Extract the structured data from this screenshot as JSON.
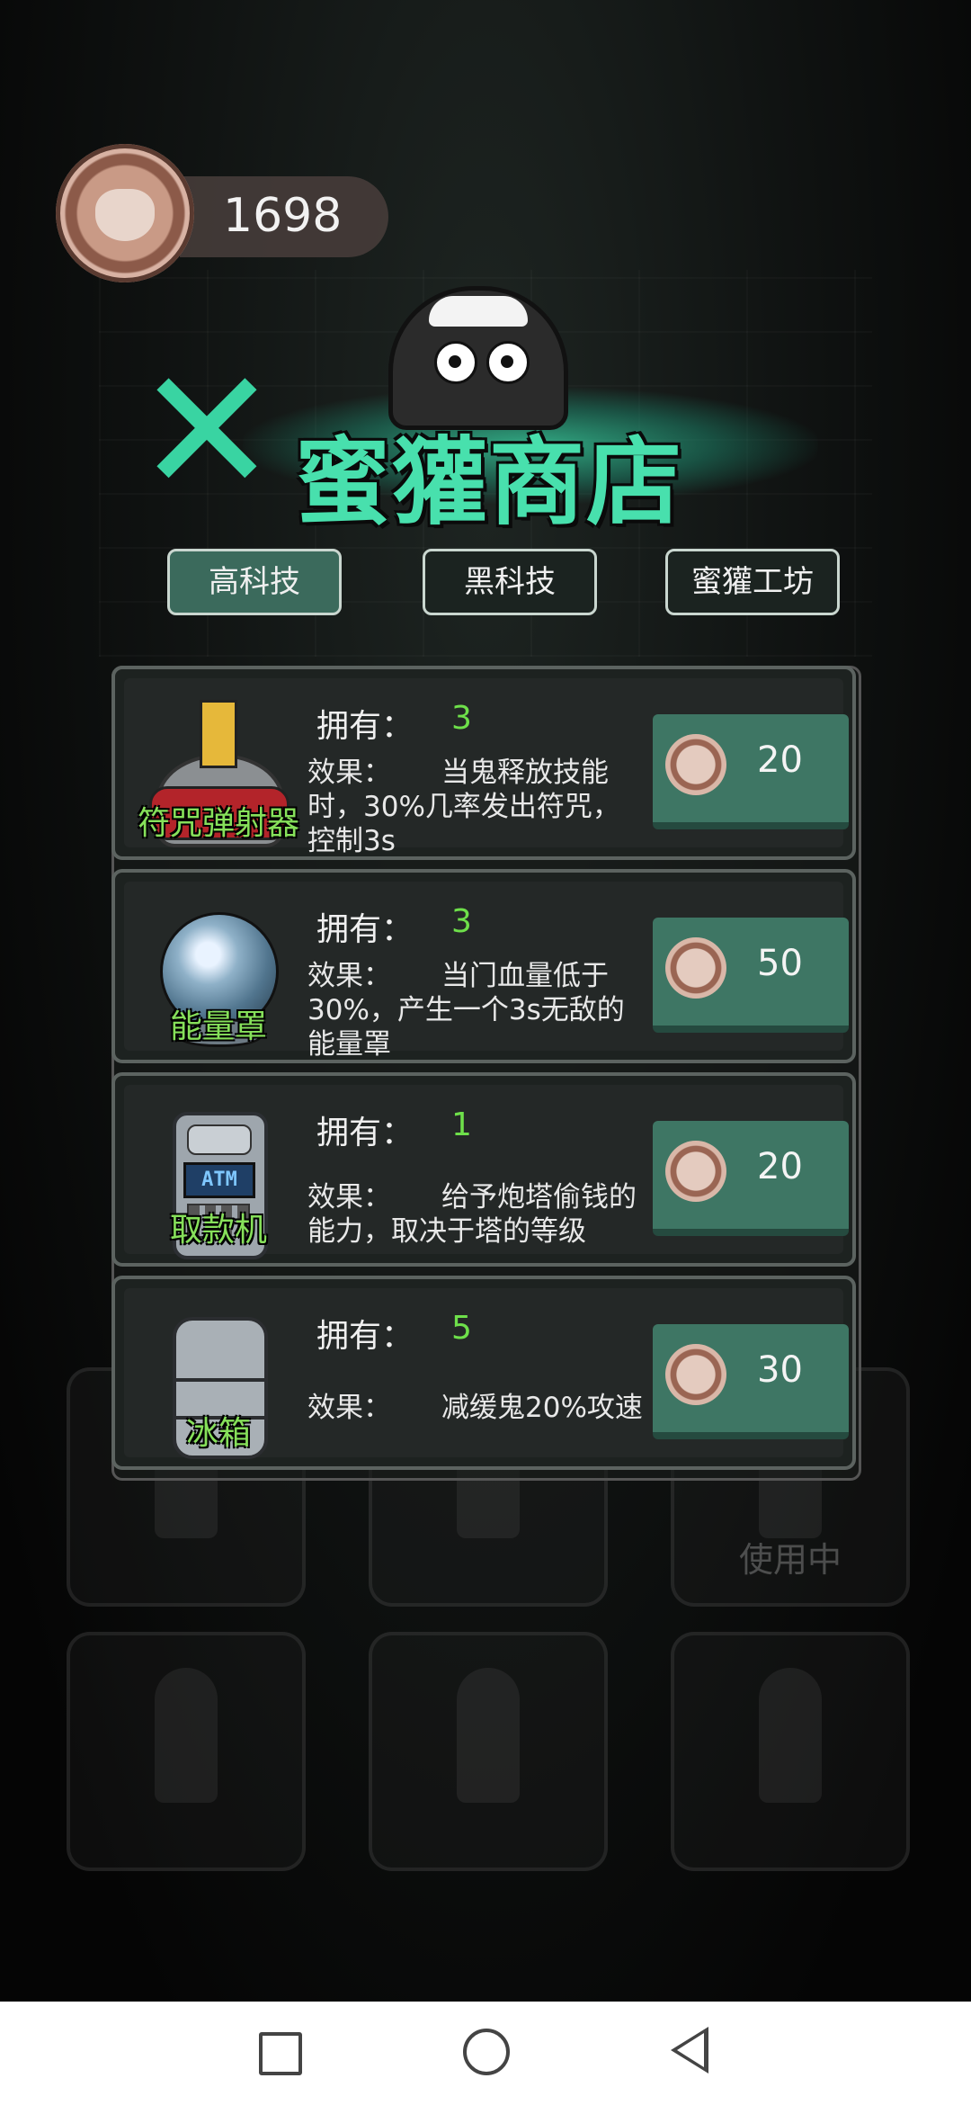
{
  "currency": {
    "amount": "1698",
    "icon": "badger-coin-icon"
  },
  "title": {
    "text": "蜜獾商店",
    "close_icon": "close-x-icon",
    "accent": "#39d4a2"
  },
  "tabs": [
    {
      "label": "高科技",
      "active": true
    },
    {
      "label": "黑科技",
      "active": false
    },
    {
      "label": "蜜獾工坊",
      "active": false
    }
  ],
  "items": [
    {
      "name": "符咒弹射器",
      "icon": "talisman-launcher-icon",
      "own_label": "拥有：",
      "own_value": "3",
      "effect_label": "效果：",
      "effect_text": "当鬼释放技能时，30%几率发出符咒，控制3s",
      "price": "20"
    },
    {
      "name": "能量罩",
      "icon": "energy-orb-icon",
      "own_label": "拥有：",
      "own_value": "3",
      "effect_label": "效果：",
      "effect_text": "当门血量低于30%，产生一个3s无敌的能量罩",
      "price": "50"
    },
    {
      "name": "取款机",
      "icon": "atm-icon",
      "atm_text": "ATM",
      "own_label": "拥有：",
      "own_value": "1",
      "effect_label": "效果：",
      "effect_text": "给予炮塔偷钱的能力，取决于塔的等级",
      "price": "20"
    },
    {
      "name": "冰箱",
      "icon": "fridge-icon",
      "own_label": "拥有：",
      "own_value": "5",
      "effect_label": "效果：",
      "effect_text": "减缓鬼20%攻速",
      "price": "30"
    }
  ],
  "background": {
    "in_use_label": "使用中"
  },
  "system_nav": {
    "recent": "square-icon",
    "home": "circle-icon",
    "back": "triangle-back-icon"
  }
}
